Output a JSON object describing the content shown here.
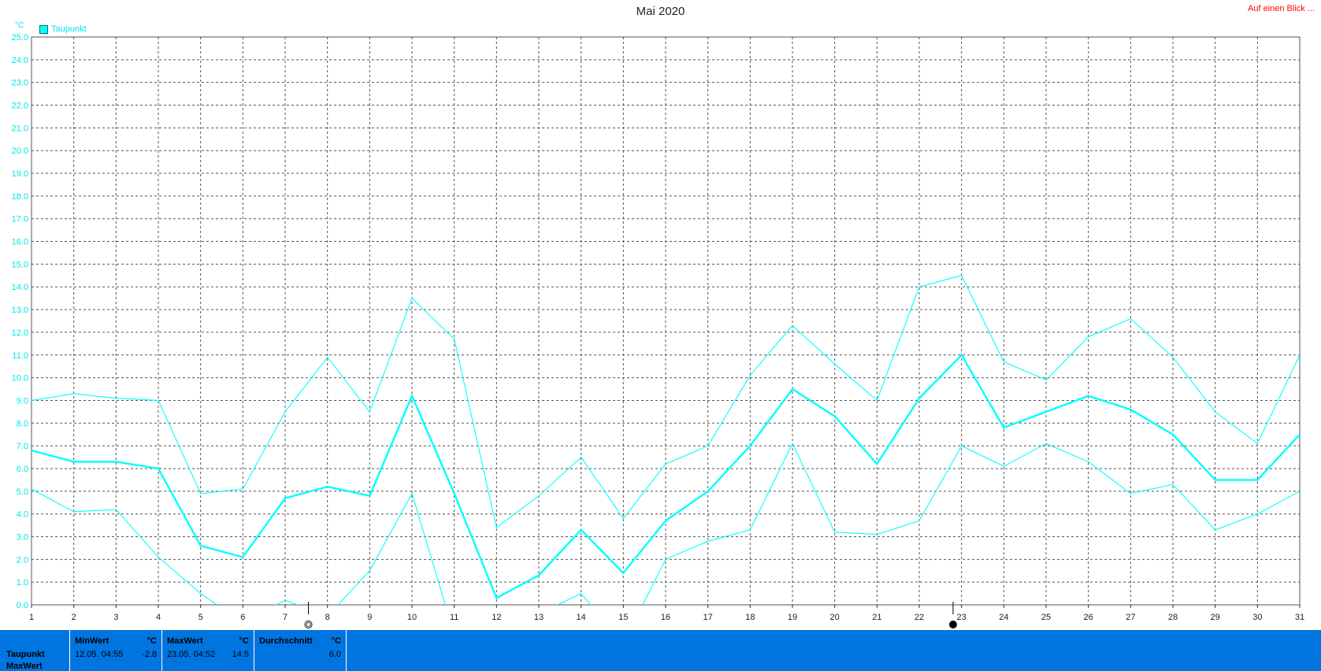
{
  "header": {
    "title": "Mai 2020",
    "quick_link": "Auf einen Blick ...",
    "legend_label": "Taupunkt",
    "unit": "°C"
  },
  "colors": {
    "series": "#00ffff",
    "panel": "#0075e0",
    "link": "#ff0000"
  },
  "moon_icons": [
    "first-quarter-moon-icon",
    "new-moon-icon"
  ],
  "chart_data": {
    "type": "line",
    "title": "Mai 2020",
    "ylabel": "°C",
    "ylim": [
      0,
      25
    ],
    "y_ticks": [
      "0.0",
      "1.0",
      "2.0",
      "3.0",
      "4.0",
      "5.0",
      "6.0",
      "7.0",
      "8.0",
      "9.0",
      "10.0",
      "11.0",
      "12.0",
      "13.0",
      "14.0",
      "15.0",
      "16.0",
      "17.0",
      "18.0",
      "19.0",
      "20.0",
      "21.0",
      "22.0",
      "23.0",
      "24.0",
      "25.0"
    ],
    "x": [
      1,
      2,
      3,
      4,
      5,
      6,
      7,
      8,
      9,
      10,
      11,
      12,
      13,
      14,
      15,
      16,
      17,
      18,
      19,
      20,
      21,
      22,
      23,
      24,
      25,
      26,
      27,
      28,
      29,
      30,
      31
    ],
    "grid": true,
    "legend": "top-left",
    "series": [
      {
        "name": "Taupunkt",
        "role": "max",
        "values": [
          9.0,
          9.3,
          9.1,
          9.0,
          4.9,
          5.1,
          8.5,
          10.9,
          8.5,
          13.5,
          11.7,
          3.4,
          4.8,
          6.5,
          3.8,
          6.2,
          7.0,
          10.1,
          12.3,
          10.6,
          9.0,
          14.0,
          14.5,
          10.7,
          9.9,
          11.8,
          12.6,
          10.9,
          8.5,
          7.1,
          11.0
        ]
      },
      {
        "name": "Taupunkt",
        "role": "mean",
        "values": [
          6.8,
          6.3,
          6.3,
          6.0,
          2.6,
          2.1,
          4.7,
          5.2,
          4.8,
          9.2,
          4.9,
          0.3,
          1.3,
          3.3,
          1.4,
          3.7,
          5.0,
          7.0,
          9.5,
          8.3,
          6.2,
          9.1,
          11.0,
          7.8,
          8.5,
          9.2,
          8.6,
          7.5,
          5.5,
          5.5,
          7.5
        ]
      },
      {
        "name": "Taupunkt",
        "role": "min",
        "values": [
          5.1,
          4.1,
          4.2,
          2.1,
          0.5,
          -0.8,
          0.2,
          -0.5,
          1.5,
          4.9,
          -1.3,
          -2.8,
          -0.4,
          0.5,
          -1.7,
          2.0,
          2.8,
          3.3,
          7.1,
          3.2,
          3.1,
          3.7,
          7.0,
          6.1,
          7.1,
          6.3,
          4.9,
          5.3,
          3.3,
          4.0,
          5.0
        ]
      }
    ],
    "moon_phase_days": [
      7.55,
      22.8
    ]
  },
  "summary": {
    "row_labels": [
      "Taupunkt",
      "MaxWert"
    ],
    "min": {
      "header": "MinWert",
      "unit": "°C",
      "date": "12.05.  04:55",
      "value": "-2.8"
    },
    "max": {
      "header": "MaxWert",
      "unit": "°C",
      "date": "23.05.  04:52",
      "value": "14.5"
    },
    "avg": {
      "header": "Durchschnitt",
      "unit": "°C",
      "value": "6.0"
    }
  }
}
